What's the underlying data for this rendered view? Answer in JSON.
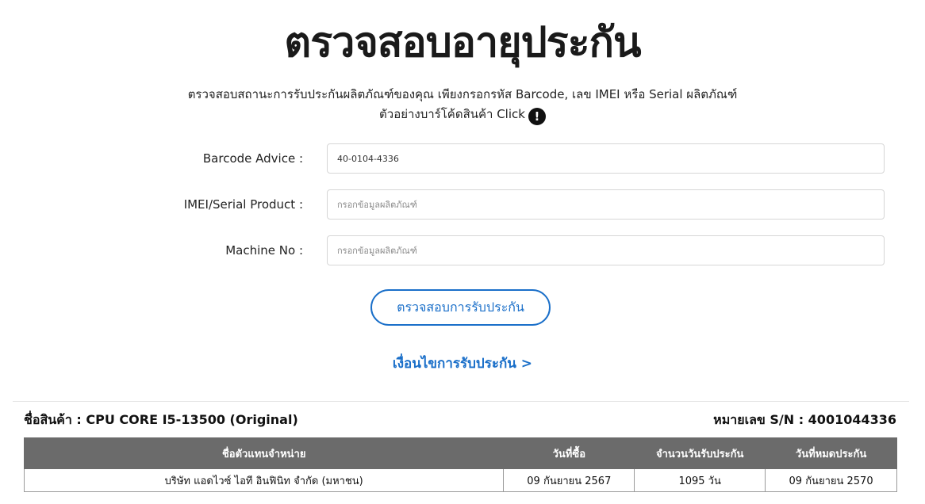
{
  "page": {
    "title": "ตรวจสอบอายุประกัน",
    "description": "ตรวจสอบสถานะการรับประกันผลิตภัณฑ์ของคุณ เพียงกรอกรหัส Barcode, เลข IMEI หรือ Serial ผลิตภัณฑ์",
    "example_text": "ตัวอย่างบาร์โค้ดสินค้า Click",
    "info_icon_glyph": "!"
  },
  "form": {
    "barcode": {
      "label": "Barcode Advice :",
      "value": "40-0104-4336",
      "placeholder": ""
    },
    "imei": {
      "label": "IMEI/Serial Product :",
      "value": "",
      "placeholder": "กรอกข้อมูลผลิตภัณฑ์"
    },
    "machine": {
      "label": "Machine No :",
      "value": "",
      "placeholder": "กรอกข้อมูลผลิตภัณฑ์"
    },
    "submit_label": "ตรวจสอบการรับประกัน",
    "conditions_link": "เงื่อนไขการรับประกัน >"
  },
  "result": {
    "product_name": "ชื่อสินค้า : CPU CORE I5-13500 (Original)",
    "serial": "หมายเลข S/N : 4001044336",
    "table": {
      "headers": [
        "ชื่อตัวแทนจำหน่าย",
        "วันที่ซื้อ",
        "จำนวนวันรับประกัน",
        "วันที่หมดประกัน"
      ],
      "rows": [
        [
          "บริษัท แอดไวซ์ ไอที อินฟินิท จำกัด (มหาชน)",
          "09 กันยายน 2567",
          "1095 วัน",
          "09 กันยายน 2570"
        ]
      ]
    }
  },
  "colors": {
    "accent": "#1a6fc9",
    "table_header": "#6b6b6b"
  }
}
